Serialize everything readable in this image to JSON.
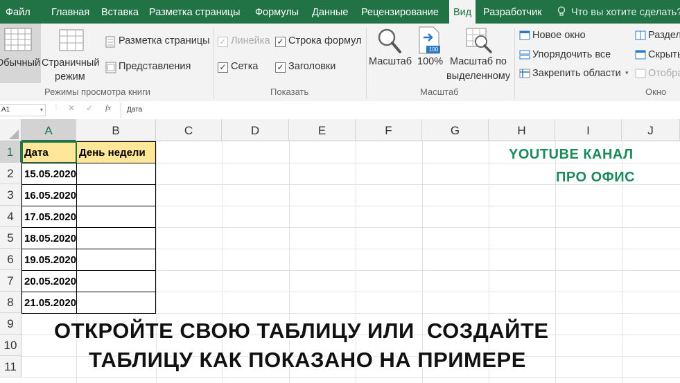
{
  "tabs": [
    "Файл",
    "Главная",
    "Вставка",
    "Разметка страницы",
    "Формулы",
    "Данные",
    "Рецензирование",
    "Вид",
    "Разработчик"
  ],
  "tell_me": "Что вы хотите сделать?",
  "ribbon": {
    "group1": {
      "normal": "Обычный",
      "page_layout_1": "Страничный",
      "page_layout_2": "режим",
      "page_markup": "Разметка страницы",
      "views": "Представления",
      "label": "Режимы просмотра книги"
    },
    "group2": {
      "ruler": "Линейка",
      "formula_bar": "Строка формул",
      "grid": "Сетка",
      "headings": "Заголовки",
      "label": "Показать"
    },
    "group3": {
      "zoom": "Масштаб",
      "zoom100": "100%",
      "zoom_sel_1": "Масштаб по",
      "zoom_sel_2": "выделенному",
      "icon100": "100",
      "label": "Масштаб"
    },
    "group4": {
      "new_window": "Новое окно",
      "arrange": "Упорядочить все",
      "freeze": "Закрепить области",
      "label": "Окно"
    },
    "group5": {
      "split": "Разделить",
      "hide": "Скрыть",
      "unhide": "Отобразить"
    }
  },
  "formula": {
    "namebox": "A1",
    "fx": "fx",
    "content": "Дата"
  },
  "columns": [
    "A",
    "B",
    "C",
    "D",
    "E",
    "F",
    "G",
    "H",
    "I",
    "J"
  ],
  "rows": [
    "1",
    "2",
    "3",
    "4",
    "5",
    "6",
    "7",
    "8",
    "9",
    "10",
    "11"
  ],
  "table": {
    "headers": [
      "Дата",
      "День недели"
    ],
    "dates": [
      "15.05.2020",
      "16.05.2020",
      "17.05.2020",
      "18.05.2020",
      "19.05.2020",
      "20.05.2020",
      "21.05.2020"
    ]
  },
  "watermark": [
    "YOUTUBE КАНАЛ",
    "ПРО ОФИС"
  ],
  "caption": [
    "ОТКРОЙТЕ СВОЮ ТАБЛИЦУ ИЛИ  СОЗДАЙТЕ",
    "ТАБЛИЦУ КАК ПОКАЗАНО НА ПРИМЕРЕ"
  ],
  "colors": {
    "excel_green": "#217346",
    "header_fill": "#ffe699",
    "watermark": "#1a8a5a"
  }
}
